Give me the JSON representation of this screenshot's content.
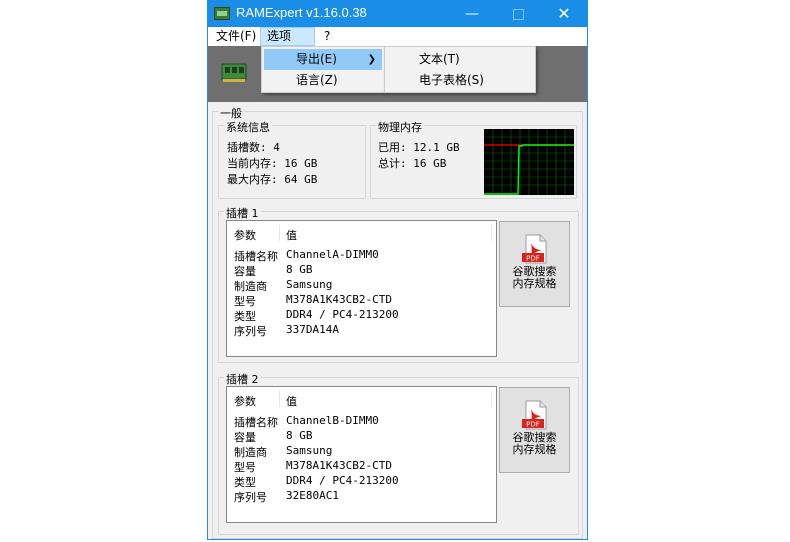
{
  "window": {
    "title": "RAMExpert v1.16.0.38"
  },
  "menu": [
    {
      "label": "文件(F)"
    },
    {
      "label": "选项(O)"
    },
    {
      "label": "?"
    }
  ],
  "options_menu": {
    "export": "导出(E)",
    "language": "语言(Z)"
  },
  "export_menu": {
    "text": "文本(T)",
    "spreadsheet": "电子表格(S)"
  },
  "general": {
    "label": "一般",
    "system_info": {
      "label": "系统信息",
      "slots": "插槽数: 4",
      "current_memory": "当前内存: 16 GB",
      "max_memory": "最大内存: 64 GB"
    },
    "physical_memory": {
      "label": "物理内存",
      "used": "已用: 12.1 GB",
      "total": "总计: 16 GB"
    }
  },
  "slots": [
    {
      "label": "插槽 1",
      "header_param": "参数",
      "header_value": "值",
      "rows": [
        {
          "param": "插槽名称",
          "value": "ChannelA-DIMM0"
        },
        {
          "param": "容量",
          "value": "8 GB"
        },
        {
          "param": "制造商",
          "value": "Samsung"
        },
        {
          "param": "型号",
          "value": "M378A1K43CB2-CTD"
        },
        {
          "param": "类型",
          "value": "DDR4 / PC4-213200"
        },
        {
          "param": "序列号",
          "value": "337DA14A"
        }
      ],
      "pdf_badge": "PDF",
      "search_line1": "谷歌搜索",
      "search_line2": "内存规格"
    },
    {
      "label": "插槽 2",
      "header_param": "参数",
      "header_value": "值",
      "rows": [
        {
          "param": "插槽名称",
          "value": "ChannelB-DIMM0"
        },
        {
          "param": "容量",
          "value": "8 GB"
        },
        {
          "param": "制造商",
          "value": "Samsung"
        },
        {
          "param": "型号",
          "value": "M378A1K43CB2-CTD"
        },
        {
          "param": "类型",
          "value": "DDR4 / PC4-213200"
        },
        {
          "param": "序列号",
          "value": "32E80AC1"
        }
      ],
      "pdf_badge": "PDF",
      "search_line1": "谷歌搜索",
      "search_line2": "内存规格"
    }
  ],
  "colors": {
    "accent": "#1a8ee6",
    "graph_line": "#00ff00",
    "graph_limit": "#ff0000",
    "highlight": "#91c9f7"
  }
}
